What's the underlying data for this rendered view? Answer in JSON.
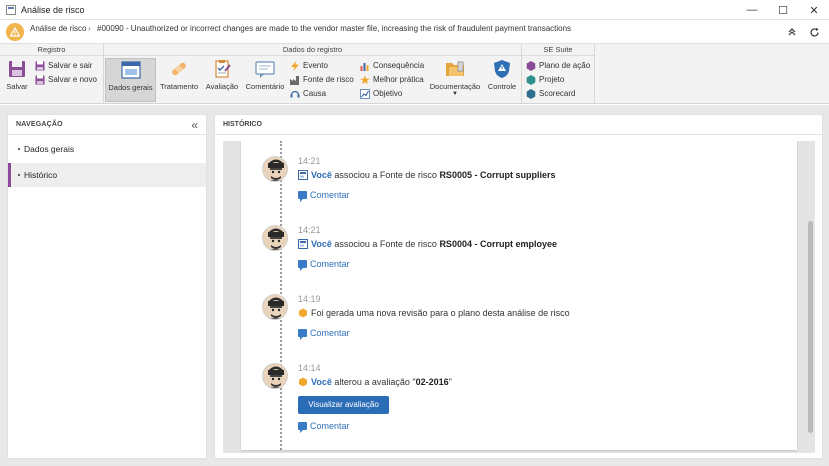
{
  "window": {
    "title": "Análise de risco",
    "minimize": "—",
    "maximize": "☐",
    "close": "✕"
  },
  "header": {
    "module": "Análise de risco",
    "separator": "›",
    "record": "#00090 - Unauthorized or incorrect changes are made to the vendor master file, increasing the risk of fraudulent payment transactions",
    "warning_color": "#f1b34b"
  },
  "ribbon": {
    "registro": {
      "title": "Registro",
      "save": "Salvar",
      "save_exit": "Salvar e sair",
      "save_new": "Salvar e novo"
    },
    "dados": {
      "title": "Dados do registro",
      "general": "Dados gerais",
      "treatment": "Tratamento",
      "evaluation": "Avaliação",
      "comment": "Comentário",
      "event": "Evento",
      "risk_source": "Fonte de risco",
      "cause": "Causa",
      "consequence": "Consequência",
      "best_practice": "Melhor prática",
      "objective": "Objetivo",
      "documentation": "Documentação",
      "control": "Controle"
    },
    "suite": {
      "title": "SE Suite",
      "action_plan": "Plano de ação",
      "project": "Projeto",
      "scorecard": "Scorecard"
    }
  },
  "navigation": {
    "title": "NAVEGAÇÃO",
    "items": [
      {
        "label": "Dados gerais",
        "active": false
      },
      {
        "label": "Histórico",
        "active": true
      }
    ],
    "active_color": "#8c4a9a"
  },
  "history": {
    "title": "HISTÓRICO",
    "comment_label": "Comentar",
    "entries": [
      {
        "time": "14:21",
        "user": "Você",
        "text": "associou a Fonte de risco",
        "bold": "RS0005 - Corrupt suppliers"
      },
      {
        "time": "14:21",
        "user": "Você",
        "text": "associou a Fonte de risco",
        "bold": "RS0004 - Corrupt employee"
      },
      {
        "time": "14:19",
        "text": "Foi gerada uma nova revisão para o plano desta análise de risco"
      },
      {
        "time": "14:14",
        "user": "Você",
        "text": "alterou a avaliação \"",
        "bold": "02-2016",
        "text_end": "\"",
        "button": "Visualizar avaliação"
      }
    ],
    "link_color": "#2f6fb5"
  }
}
